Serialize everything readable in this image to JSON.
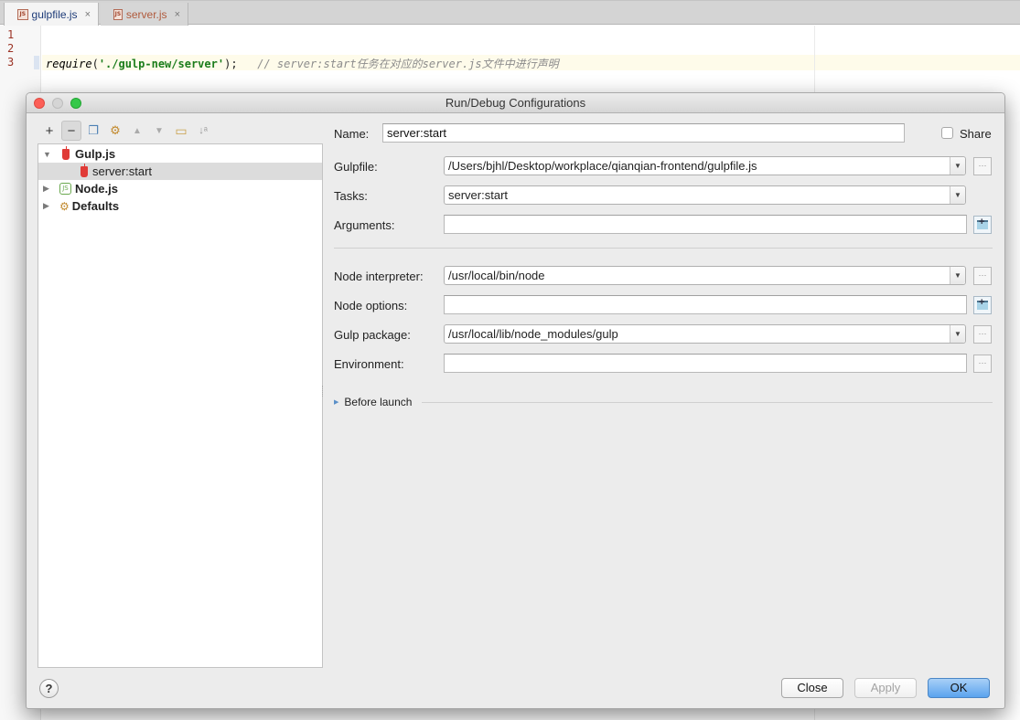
{
  "editor": {
    "tabs": [
      {
        "label": "gulpfile.js",
        "icon": "js-file-icon",
        "active": true
      },
      {
        "label": "server.js",
        "icon": "js-file-icon",
        "active": false
      }
    ],
    "line_numbers": [
      "1",
      "2",
      "3"
    ],
    "code": {
      "fn": "require",
      "open": "(",
      "string": "'./gulp-new/server'",
      "close": ");",
      "comment": "// server:start任务在对应的server.js文件中进行声明"
    },
    "close_glyph": "×"
  },
  "dialog": {
    "title": "Run/Debug Configurations",
    "toolbar": [
      {
        "name": "add",
        "glyph": "+"
      },
      {
        "name": "remove",
        "glyph": "−"
      },
      {
        "name": "copy",
        "glyph": "❐"
      },
      {
        "name": "edit-defaults",
        "glyph": "⚙"
      },
      {
        "name": "move-up",
        "glyph": "▲"
      },
      {
        "name": "move-down",
        "glyph": "▼"
      },
      {
        "name": "folder",
        "glyph": "▭"
      },
      {
        "name": "sort",
        "glyph": "↓ᵃ"
      }
    ],
    "tree": [
      {
        "label": "Gulp.js",
        "expanded": true,
        "icon": "gulp-icon",
        "level": 0
      },
      {
        "label": "server:start",
        "icon": "gulp-icon",
        "level": 1,
        "selected": true
      },
      {
        "label": "Node.js",
        "expanded": false,
        "icon": "nodejs-icon",
        "level": 0
      },
      {
        "label": "Defaults",
        "expanded": false,
        "icon": "wrench-icon",
        "level": 0
      }
    ],
    "form": {
      "name_label": "Name:",
      "name_value": "server:start",
      "share_label": "Share",
      "share_checked": false,
      "gulpfile_label": "Gulpfile:",
      "gulpfile_value": "/Users/bjhl/Desktop/workplace/qianqian-frontend/gulpfile.js",
      "tasks_label": "Tasks:",
      "tasks_value": "server:start",
      "arguments_label": "Arguments:",
      "arguments_value": "",
      "node_interpreter_label": "Node interpreter:",
      "node_interpreter_value": "/usr/local/bin/node",
      "node_options_label": "Node options:",
      "node_options_value": "",
      "gulp_package_label": "Gulp package:",
      "gulp_package_value": "/usr/local/lib/node_modules/gulp",
      "environment_label": "Environment:",
      "environment_value": "",
      "before_launch_label": "Before launch"
    },
    "glyphs": {
      "dropdown": "▼",
      "ellipsis": "···",
      "help": "?",
      "tree_expanded": "▼",
      "tree_collapsed": "▶",
      "before_launch_arrow": "▶",
      "node_badge": "JS",
      "wrench": "⚙"
    },
    "buttons": {
      "close": "Close",
      "apply": "Apply",
      "ok": "OK"
    }
  }
}
